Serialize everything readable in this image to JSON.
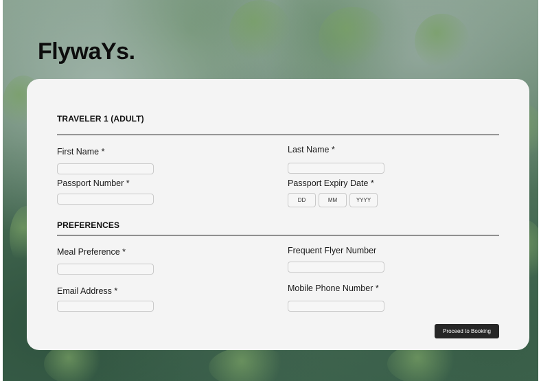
{
  "brand": {
    "logo_text": "FlywaYs."
  },
  "colors": {
    "card_background": "#f4f4f4",
    "button_background": "#262626",
    "text": "#111111"
  },
  "traveler_section": {
    "title": "TRAVELER 1 (ADULT)",
    "first_name": {
      "label": "First Name *",
      "value": ""
    },
    "last_name": {
      "label": "Last Name *",
      "value": ""
    },
    "passport_number": {
      "label": "Passport Number *",
      "value": ""
    },
    "passport_expiry": {
      "label": "Passport Expiry Date *",
      "day_placeholder": "DD",
      "month_placeholder": "MM",
      "year_placeholder": "YYYY"
    }
  },
  "preferences_section": {
    "title": "PREFERENCES",
    "meal_preference": {
      "label": "Meal Preference *",
      "value": ""
    },
    "frequent_flyer": {
      "label": "Frequent Flyer Number",
      "value": ""
    },
    "email": {
      "label": "Email Address *",
      "value": ""
    },
    "mobile_phone": {
      "label": "Mobile Phone Number *",
      "value": ""
    }
  },
  "actions": {
    "proceed_label": "Proceed to Booking"
  }
}
